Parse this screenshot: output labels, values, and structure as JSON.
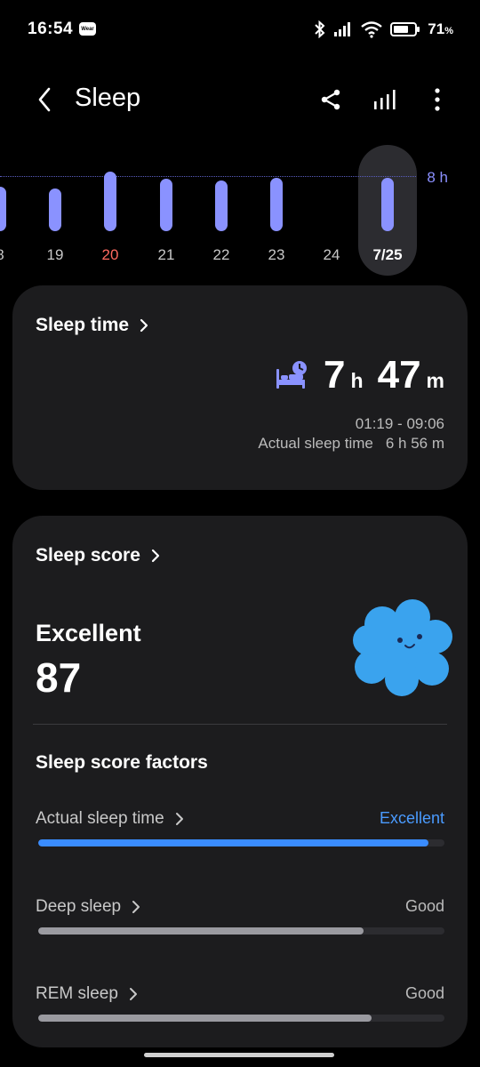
{
  "status_bar": {
    "time": "16:54",
    "wear_badge": "Wear",
    "battery_percent": "71",
    "battery_unit": "%",
    "battery_level": 0.71
  },
  "app_bar": {
    "title": "Sleep",
    "icons": [
      "back-icon",
      "share-icon",
      "bar-chart-icon",
      "more-vertical-icon"
    ]
  },
  "chart": {
    "target_label": "8 h",
    "days": [
      {
        "label": "8",
        "hours": 6.4,
        "style": "normal"
      },
      {
        "label": "19",
        "hours": 6.2,
        "style": "normal"
      },
      {
        "label": "20",
        "hours": 8.6,
        "style": "red"
      },
      {
        "label": "21",
        "hours": 7.6,
        "style": "normal"
      },
      {
        "label": "22",
        "hours": 7.4,
        "style": "normal"
      },
      {
        "label": "23",
        "hours": 7.8,
        "style": "normal"
      },
      {
        "label": "24",
        "hours": null,
        "style": "normal"
      },
      {
        "label": "7/25",
        "hours": 7.8,
        "style": "selected"
      }
    ]
  },
  "sleep_time_card": {
    "heading": "Sleep time",
    "hours": "7",
    "hours_unit": "h",
    "minutes": "47",
    "minutes_unit": "m",
    "range": "01:19 - 09:06",
    "actual_label": "Actual sleep time",
    "actual_value": "6 h 56 m"
  },
  "score_card": {
    "heading": "Sleep score",
    "rating": "Excellent",
    "score": "87",
    "factors_title": "Sleep score factors",
    "factors": [
      {
        "name": "Actual sleep time",
        "rating": "Excellent",
        "level": 0.96,
        "color": "#3a8cff"
      },
      {
        "name": "Deep sleep",
        "rating": "Good",
        "level": 0.8,
        "color": "#9a9aa0"
      },
      {
        "name": "REM sleep",
        "rating": "Good",
        "level": 0.82,
        "color": "#9a9aa0"
      }
    ]
  },
  "colors": {
    "bar": "#8a92ff",
    "accent_blue": "#3a8cff",
    "red_day": "#ff6a60",
    "card_bg": "#1c1c1e"
  }
}
